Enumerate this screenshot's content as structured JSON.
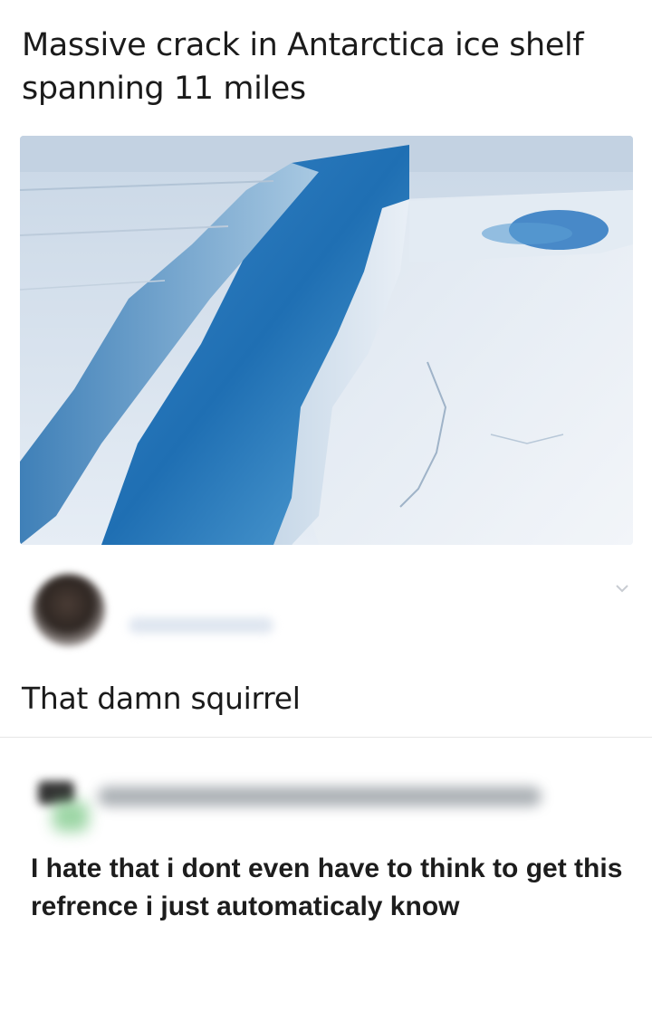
{
  "post": {
    "title": "Massive crack in Antarctica ice shelf spanning 11 miles"
  },
  "comments": [
    {
      "text": "That damn squirrel",
      "avatar_icon": "profile-photo-blurred",
      "menu_icon": "chevron-down-icon"
    },
    {
      "text": "I hate that i dont even have to think to get this refrence i just automaticaly know",
      "avatar_icon": "profile-photo-blurred"
    }
  ],
  "colors": {
    "ice_blue": "#1e6fb5",
    "snow": "#dfe8f1",
    "text": "#1b1b1b",
    "divider": "#e6e6e6"
  }
}
